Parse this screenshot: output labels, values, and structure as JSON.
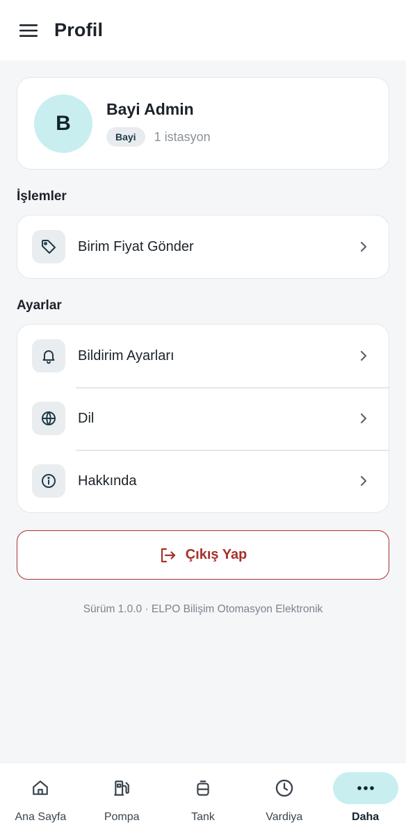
{
  "appbar": {
    "title": "Profil"
  },
  "profile": {
    "initial": "B",
    "name": "Bayi Admin",
    "role": "Bayi",
    "stations": "1 istasyon"
  },
  "sections": {
    "operations": {
      "title": "İşlemler",
      "items": [
        {
          "label": "Birim Fiyat Gönder",
          "icon": "tag-icon"
        }
      ]
    },
    "settings": {
      "title": "Ayarlar",
      "items": [
        {
          "label": "Bildirim Ayarları",
          "icon": "bell-icon"
        },
        {
          "label": "Dil",
          "icon": "globe-icon"
        },
        {
          "label": "Hakkında",
          "icon": "info-icon"
        }
      ]
    }
  },
  "logout": {
    "label": "Çıkış Yap"
  },
  "footer": {
    "version": "Sürüm 1.0.0 · ELPO Bilişim Otomasyon Elektronik"
  },
  "nav": {
    "items": [
      {
        "label": "Ana Sayfa",
        "icon": "home-icon"
      },
      {
        "label": "Pompa",
        "icon": "fuel-pump-icon"
      },
      {
        "label": "Tank",
        "icon": "tank-icon"
      },
      {
        "label": "Vardiya",
        "icon": "clock-icon"
      },
      {
        "label": "Daha",
        "icon": "more-icon",
        "active": true
      }
    ]
  },
  "colors": {
    "accent": "#c8eef0",
    "danger": "#a8302b",
    "background": "#f5f6f8"
  }
}
